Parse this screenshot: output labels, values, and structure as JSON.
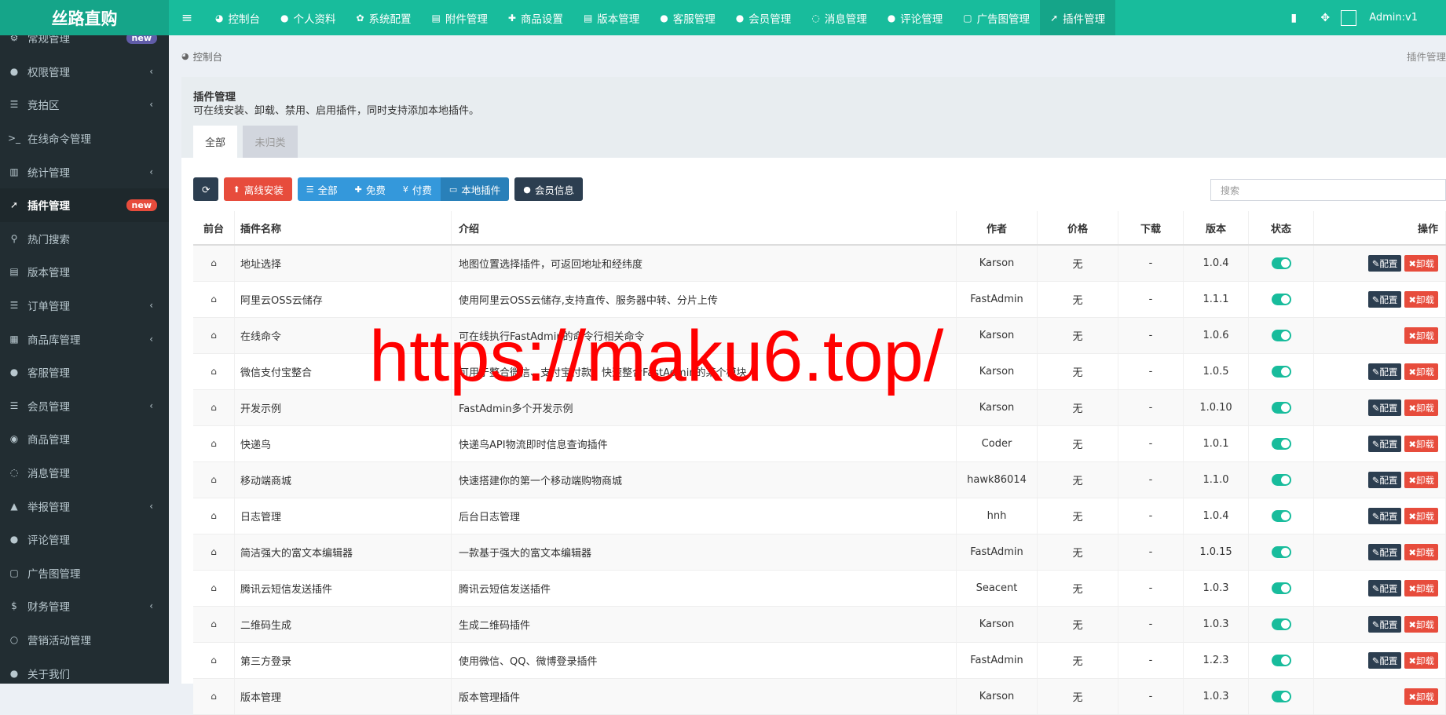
{
  "app": {
    "logo": "丝路直购"
  },
  "topnav": [
    {
      "icon": "dashboard-icon",
      "glyph": "◕",
      "label": "控制台"
    },
    {
      "icon": "user-icon",
      "glyph": "●",
      "label": "个人资料"
    },
    {
      "icon": "gear-icon",
      "glyph": "✿",
      "label": "系统配置"
    },
    {
      "icon": "file-icon",
      "glyph": "▤",
      "label": "附件管理"
    },
    {
      "icon": "gift-icon",
      "glyph": "✚",
      "label": "商品设置"
    },
    {
      "icon": "file-icon",
      "glyph": "▤",
      "label": "版本管理"
    },
    {
      "icon": "user-icon",
      "glyph": "●",
      "label": "客服管理"
    },
    {
      "icon": "user-icon",
      "glyph": "●",
      "label": "会员管理"
    },
    {
      "icon": "chat-icon",
      "glyph": "◌",
      "label": "消息管理"
    },
    {
      "icon": "comment-icon",
      "glyph": "●",
      "label": "评论管理"
    },
    {
      "icon": "file-icon",
      "glyph": "▢",
      "label": "广告图管理"
    },
    {
      "icon": "rocket-icon",
      "glyph": "➚",
      "label": "插件管理",
      "active": true
    }
  ],
  "header_right": {
    "admin_name": "Admin:v1",
    "avatar_alt": "Admin"
  },
  "sidebar": [
    {
      "label": "常规管理",
      "glyph": "⚙",
      "badge": "new",
      "badge_color": "#605ca8"
    },
    {
      "label": "权限管理",
      "glyph": "●",
      "chevron": true
    },
    {
      "label": "竞拍区",
      "glyph": "☰",
      "chevron": true
    },
    {
      "label": "在线命令管理",
      "glyph": ">_"
    },
    {
      "label": "统计管理",
      "glyph": "▥",
      "chevron": true
    },
    {
      "label": "插件管理",
      "glyph": "➚",
      "active": true,
      "badge": "new",
      "badge_color": "#e74c3c"
    },
    {
      "label": "热门搜索",
      "glyph": "⚲"
    },
    {
      "label": "版本管理",
      "glyph": "▤"
    },
    {
      "label": "订单管理",
      "glyph": "☰",
      "chevron": true
    },
    {
      "label": "商品库管理",
      "glyph": "▦",
      "chevron": true
    },
    {
      "label": "客服管理",
      "glyph": "●"
    },
    {
      "label": "会员管理",
      "glyph": "☰",
      "chevron": true
    },
    {
      "label": "商品管理",
      "glyph": "◉"
    },
    {
      "label": "消息管理",
      "glyph": "◌"
    },
    {
      "label": "举报管理",
      "glyph": "▲",
      "chevron": true
    },
    {
      "label": "评论管理",
      "glyph": "●"
    },
    {
      "label": "广告图管理",
      "glyph": "▢"
    },
    {
      "label": "财务管理",
      "glyph": "$",
      "chevron": true
    },
    {
      "label": "营销活动管理",
      "glyph": "○"
    },
    {
      "label": "关于我们",
      "glyph": "●"
    }
  ],
  "breadcrumb": {
    "label": "控制台",
    "right": "插件管理"
  },
  "panel": {
    "title": "插件管理",
    "desc": "可在线安装、卸载、禁用、启用插件，同时支持添加本地插件。",
    "tabs": [
      "全部",
      "未归类"
    ]
  },
  "toolbar": {
    "offline_install": "离线安装",
    "filters": [
      "全部",
      "免费",
      "付费",
      "本地插件"
    ],
    "member_info": "会员信息",
    "search_placeholder": "搜索"
  },
  "table": {
    "headers": [
      "前台",
      "插件名称",
      "介绍",
      "作者",
      "价格",
      "下载",
      "版本",
      "状态",
      "操作"
    ],
    "config_label": "配置",
    "uninstall_label": "卸载",
    "rows": [
      {
        "name": "地址选择",
        "intro": "地图位置选择插件，可返回地址和经纬度",
        "author": "Karson",
        "price": "无",
        "download": "-",
        "version": "1.0.4",
        "config": true
      },
      {
        "name": "阿里云OSS云储存",
        "intro": "使用阿里云OSS云储存,支持直传、服务器中转、分片上传",
        "author": "FastAdmin",
        "price": "无",
        "download": "-",
        "version": "1.1.1",
        "config": true
      },
      {
        "name": "在线命令",
        "intro": "可在线执行FastAdmin的命令行相关命令",
        "author": "Karson",
        "price": "无",
        "download": "-",
        "version": "1.0.6",
        "config": false
      },
      {
        "name": "微信支付宝整合",
        "intro": "可用于整合微信、支付宝付款，快速整合FastAdmin的某个模块",
        "author": "Karson",
        "price": "无",
        "download": "-",
        "version": "1.0.5",
        "config": true
      },
      {
        "name": "开发示例",
        "intro": "FastAdmin多个开发示例",
        "author": "Karson",
        "price": "无",
        "download": "-",
        "version": "1.0.10",
        "config": true
      },
      {
        "name": "快递鸟",
        "intro": "快递鸟API物流即时信息查询插件",
        "author": "Coder",
        "price": "无",
        "download": "-",
        "version": "1.0.1",
        "config": true
      },
      {
        "name": "移动端商城",
        "intro": "快速搭建你的第一个移动端购物商城",
        "author": "hawk86014",
        "price": "无",
        "download": "-",
        "version": "1.1.0",
        "config": true
      },
      {
        "name": "日志管理",
        "intro": "后台日志管理",
        "author": "hnh",
        "price": "无",
        "download": "-",
        "version": "1.0.4",
        "config": true
      },
      {
        "name": "简洁强大的富文本编辑器",
        "intro": "一款基于强大的富文本编辑器",
        "author": "FastAdmin",
        "price": "无",
        "download": "-",
        "version": "1.0.15",
        "config": true
      },
      {
        "name": "腾讯云短信发送插件",
        "intro": "腾讯云短信发送插件",
        "author": "Seacent",
        "price": "无",
        "download": "-",
        "version": "1.0.3",
        "config": true
      },
      {
        "name": "二维码生成",
        "intro": "生成二维码插件",
        "author": "Karson",
        "price": "无",
        "download": "-",
        "version": "1.0.3",
        "config": true
      },
      {
        "name": "第三方登录",
        "intro": "使用微信、QQ、微博登录插件",
        "author": "FastAdmin",
        "price": "无",
        "download": "-",
        "version": "1.2.3",
        "config": true
      },
      {
        "name": "版本管理",
        "intro": "版本管理插件",
        "author": "Karson",
        "price": "无",
        "download": "-",
        "version": "1.0.3",
        "config": false
      }
    ]
  },
  "watermark": "https://maku6.top/"
}
